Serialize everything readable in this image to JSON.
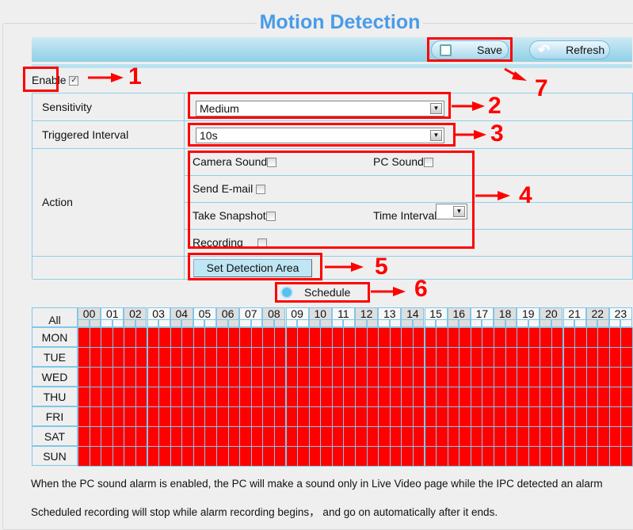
{
  "title": "Motion Detection",
  "toolbar": {
    "save_label": "Save",
    "refresh_label": "Refresh"
  },
  "enable": {
    "label": "Enable",
    "checked": true
  },
  "form": {
    "sensitivity": {
      "label": "Sensitivity",
      "value": "Medium"
    },
    "triggered_interval": {
      "label": "Triggered Interval",
      "value": "10s"
    },
    "action": {
      "label": "Action",
      "camera_sound": "Camera Sound",
      "pc_sound": "PC Sound",
      "send_email": "Send E-mail",
      "take_snapshot": "Take Snapshot",
      "time_interval": "Time Interval",
      "time_interval_value": "",
      "recording": "Recording"
    },
    "set_detection_area": "Set Detection Area"
  },
  "schedule": {
    "button_label": "Schedule",
    "all_label": "All",
    "hours": [
      "00",
      "01",
      "02",
      "03",
      "04",
      "05",
      "06",
      "07",
      "08",
      "09",
      "10",
      "11",
      "12",
      "13",
      "14",
      "15",
      "16",
      "17",
      "18",
      "19",
      "20",
      "21",
      "22",
      "23"
    ],
    "days": [
      "MON",
      "TUE",
      "WED",
      "THU",
      "FRI",
      "SAT",
      "SUN"
    ],
    "all_selected": true,
    "selected_color": "#ff0000"
  },
  "notes": [
    "When the PC sound alarm is enabled, the PC will make a sound only in Live Video page while the IPC detected an alarm",
    "Scheduled recording will stop while alarm recording begins， and go on automatically after it ends."
  ],
  "annotations": [
    "1",
    "2",
    "3",
    "4",
    "5",
    "6",
    "7"
  ],
  "colors": {
    "accent": "#4a9be8",
    "annotation": "#ff0000",
    "border": "#8ecfe8"
  }
}
